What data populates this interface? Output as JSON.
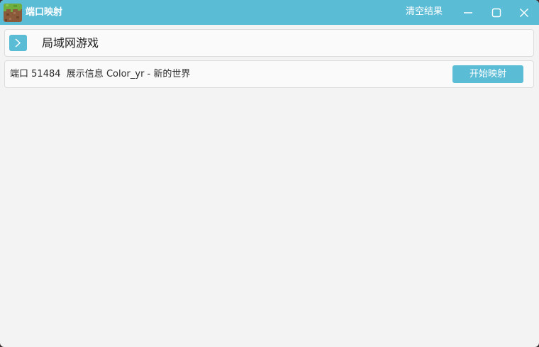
{
  "window": {
    "title": "端口映射",
    "clear_label": "清空结果",
    "accent_color": "#5bbcd6"
  },
  "section": {
    "title": "局域网游戏"
  },
  "mapping": {
    "port_label": "端口",
    "port_value": "51484",
    "info_label": "展示信息",
    "info_value": "Color_yr - 新的世界",
    "start_label": "开始映射"
  },
  "icons": {
    "app": "minecraft-grass-block-icon",
    "expand": "chevron-right-icon",
    "minimize": "minimize-icon",
    "maximize": "maximize-icon",
    "close": "close-icon"
  }
}
